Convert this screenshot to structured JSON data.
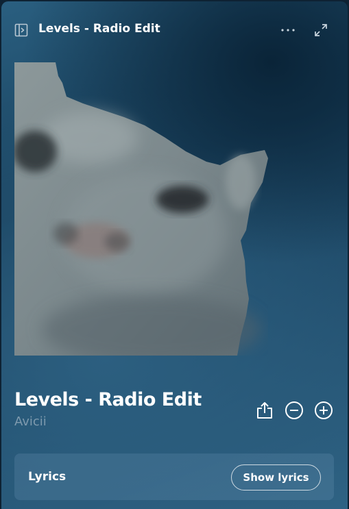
{
  "header": {
    "title": "Levels - Radio Edit",
    "sidebar_icon": "sidebar-toggle-icon",
    "more_icon": "more-options-icon",
    "expand_icon": "expand-icon"
  },
  "artwork": {
    "description_icon": "album-art",
    "colors": {
      "fur": "#6f7f84",
      "fur_light": "#9aa6a8",
      "eye": "#2a2f33",
      "nose": "#8a7a78"
    }
  },
  "track": {
    "title": "Levels - Radio Edit",
    "artist": "Avicii"
  },
  "actions": {
    "share_icon": "share-icon",
    "remove_icon": "minus-circle-icon",
    "add_icon": "plus-circle-icon"
  },
  "lyrics": {
    "label": "Lyrics",
    "button_label": "Show lyrics"
  },
  "colors": {
    "background_top": "#0a2438",
    "background_mid": "#2a5f80",
    "text_primary": "#ffffff",
    "text_secondary": "#7e9aae"
  }
}
